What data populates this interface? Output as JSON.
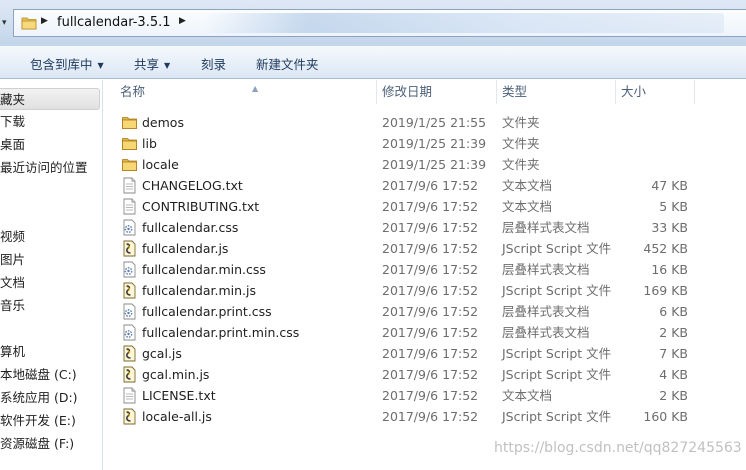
{
  "address_bar": {
    "path_segment": "fullcalendar-3.5.1"
  },
  "toolbar": {
    "items": [
      {
        "label": "包含到库中",
        "has_dropdown": true
      },
      {
        "label": "共享",
        "has_dropdown": true
      },
      {
        "label": "刻录",
        "has_dropdown": false
      },
      {
        "label": "新建文件夹",
        "has_dropdown": false
      }
    ]
  },
  "nav_pane": {
    "items": [
      {
        "label": "藏夹",
        "selected": true
      },
      {
        "label": "下载"
      },
      {
        "label": "桌面"
      },
      {
        "label": "最近访问的位置"
      },
      {
        "label": ""
      },
      {
        "label": "视频"
      },
      {
        "label": "图片"
      },
      {
        "label": "文档"
      },
      {
        "label": "音乐"
      },
      {
        "label": ""
      },
      {
        "label": "算机"
      },
      {
        "label": "本地磁盘 (C:)"
      },
      {
        "label": "系统应用 (D:)"
      },
      {
        "label": "软件开发 (E:)"
      },
      {
        "label": "资源磁盘 (F:)"
      }
    ]
  },
  "columns": {
    "name": "名称",
    "date": "修改日期",
    "type": "类型",
    "size": "大小"
  },
  "files": [
    {
      "name": "demos",
      "date": "2019/1/25 21:55",
      "type": "文件夹",
      "size": "",
      "icon": "folder-icon"
    },
    {
      "name": "lib",
      "date": "2019/1/25 21:39",
      "type": "文件夹",
      "size": "",
      "icon": "folder-icon"
    },
    {
      "name": "locale",
      "date": "2019/1/25 21:39",
      "type": "文件夹",
      "size": "",
      "icon": "folder-icon"
    },
    {
      "name": "CHANGELOG.txt",
      "date": "2017/9/6 17:52",
      "type": "文本文档",
      "size": "47 KB",
      "icon": "text-file-icon"
    },
    {
      "name": "CONTRIBUTING.txt",
      "date": "2017/9/6 17:52",
      "type": "文本文档",
      "size": "5 KB",
      "icon": "text-file-icon"
    },
    {
      "name": "fullcalendar.css",
      "date": "2017/9/6 17:52",
      "type": "层叠样式表文档",
      "size": "33 KB",
      "icon": "css-file-icon"
    },
    {
      "name": "fullcalendar.js",
      "date": "2017/9/6 17:52",
      "type": "JScript Script 文件",
      "size": "452 KB",
      "icon": "js-file-icon"
    },
    {
      "name": "fullcalendar.min.css",
      "date": "2017/9/6 17:52",
      "type": "层叠样式表文档",
      "size": "16 KB",
      "icon": "css-file-icon"
    },
    {
      "name": "fullcalendar.min.js",
      "date": "2017/9/6 17:52",
      "type": "JScript Script 文件",
      "size": "169 KB",
      "icon": "js-file-icon"
    },
    {
      "name": "fullcalendar.print.css",
      "date": "2017/9/6 17:52",
      "type": "层叠样式表文档",
      "size": "6 KB",
      "icon": "css-file-icon"
    },
    {
      "name": "fullcalendar.print.min.css",
      "date": "2017/9/6 17:52",
      "type": "层叠样式表文档",
      "size": "2 KB",
      "icon": "css-file-icon"
    },
    {
      "name": "gcal.js",
      "date": "2017/9/6 17:52",
      "type": "JScript Script 文件",
      "size": "7 KB",
      "icon": "js-file-icon"
    },
    {
      "name": "gcal.min.js",
      "date": "2017/9/6 17:52",
      "type": "JScript Script 文件",
      "size": "4 KB",
      "icon": "js-file-icon"
    },
    {
      "name": "LICENSE.txt",
      "date": "2017/9/6 17:52",
      "type": "文本文档",
      "size": "2 KB",
      "icon": "text-file-icon"
    },
    {
      "name": "locale-all.js",
      "date": "2017/9/6 17:52",
      "type": "JScript Script 文件",
      "size": "160 KB",
      "icon": "js-file-icon"
    }
  ],
  "watermark": "https://blog.csdn.net/qq827245563"
}
